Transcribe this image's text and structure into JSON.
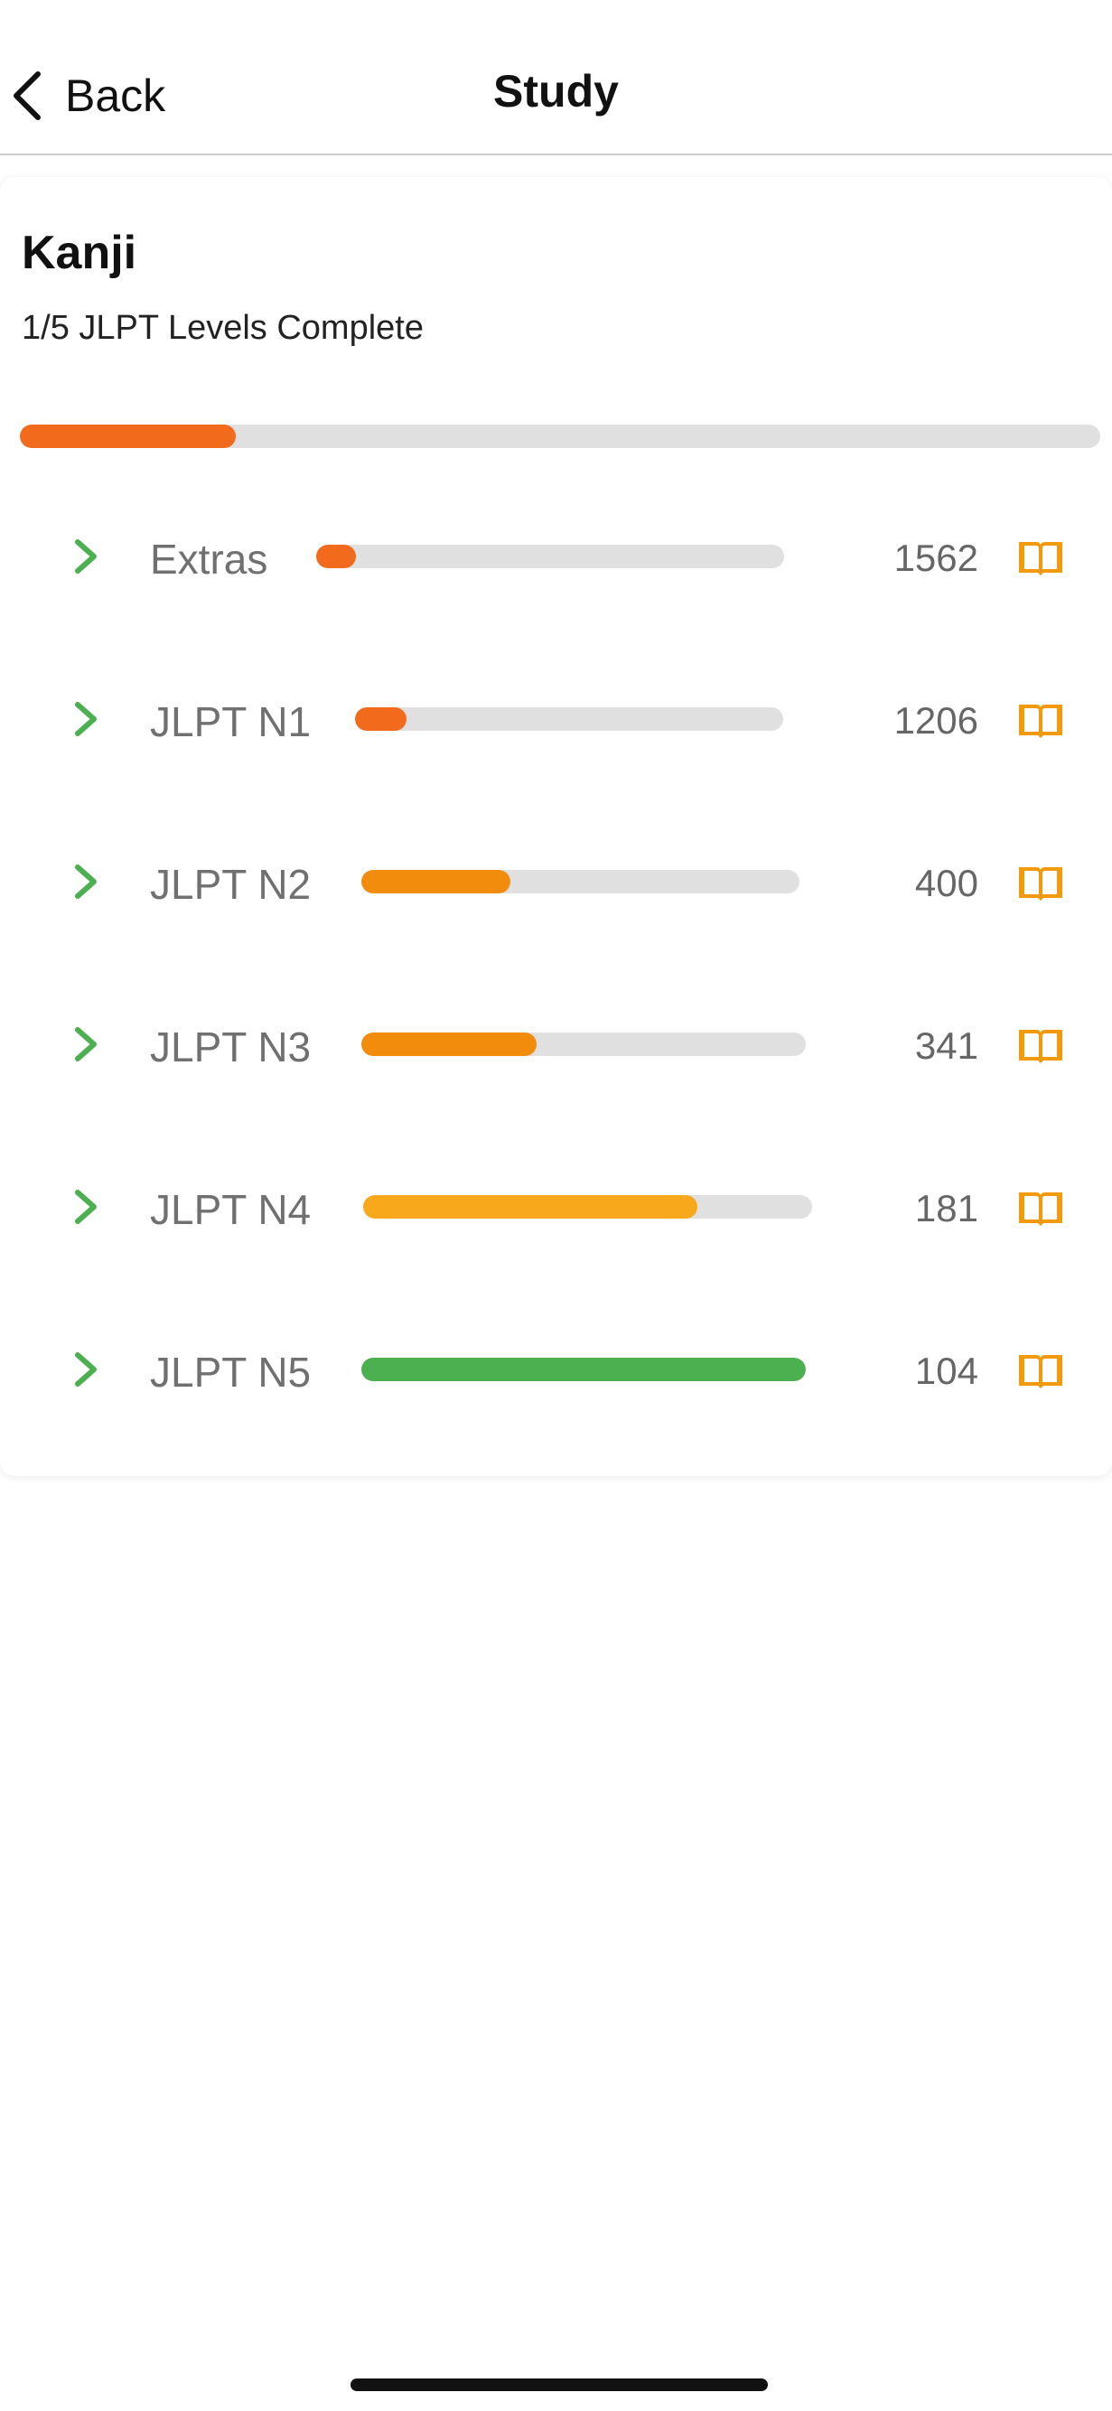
{
  "nav": {
    "back_label": "Back",
    "title": "Study"
  },
  "card": {
    "title": "Kanji",
    "subtitle": "1/5 JLPT Levels Complete",
    "overall_progress": 0.2,
    "overall_color": "#f26a1b"
  },
  "levels": [
    {
      "label": "Extras",
      "count": "1562",
      "progress": 0.085,
      "color": "#f26a1b"
    },
    {
      "label": "JLPT N1",
      "count": "1206",
      "progress": 0.12,
      "color": "#f26a1b"
    },
    {
      "label": "JLPT N2",
      "count": "400",
      "progress": 0.34,
      "color": "#f28c0c"
    },
    {
      "label": "JLPT N3",
      "count": "341",
      "progress": 0.395,
      "color": "#f28c0c"
    },
    {
      "label": "JLPT N4",
      "count": "181",
      "progress": 0.745,
      "color": "#f7a81b"
    },
    {
      "label": "JLPT N5",
      "count": "104",
      "progress": 1.0,
      "color": "#4caf50"
    }
  ],
  "icons": {
    "chevron": "chevron-right-icon",
    "book": "book-icon",
    "back": "chevron-left-icon"
  },
  "colors": {
    "chevron": "#4caf50",
    "book": "#f29a0e",
    "track": "#e0e0e0"
  }
}
